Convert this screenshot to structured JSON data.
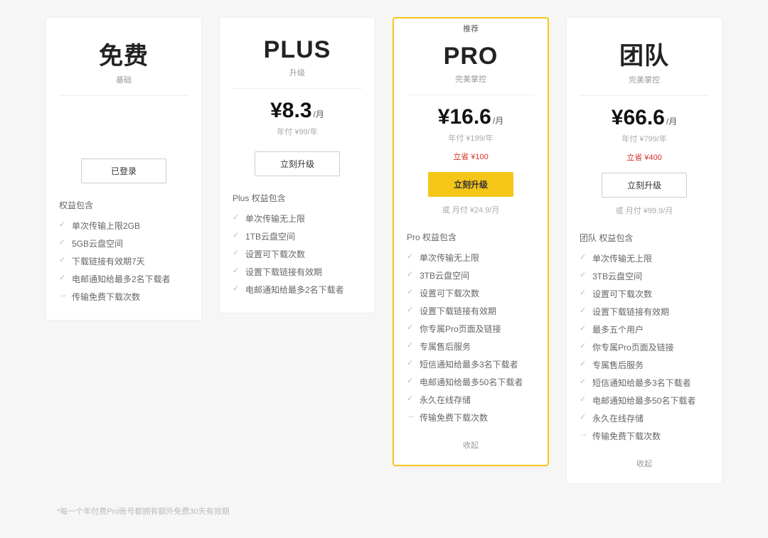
{
  "plans": {
    "free": {
      "title": "免费",
      "subtitle": "基础",
      "button": "已登录",
      "feat_title": "权益包含",
      "features": [
        "单次传输上限2GB",
        "5GB云盘空间",
        "下载链接有效期7天",
        "电邮通知给最多2名下载者",
        "传输免费下载次数"
      ]
    },
    "plus": {
      "title": "PLUS",
      "subtitle": "升级",
      "price": "¥8.3",
      "unit": "/月",
      "annual": "年付 ¥99/年",
      "button": "立刻升级",
      "feat_title": "Plus 权益包含",
      "features": [
        "单次传输无上限",
        "1TB云盘空间",
        "设置可下载次数",
        "设置下载链接有效期",
        "电邮通知给最多2名下载者"
      ]
    },
    "pro": {
      "recommend": "推荐",
      "title": "PRO",
      "subtitle": "完美掌控",
      "price": "¥16.6",
      "unit": "/月",
      "annual": "年付 ¥199/年",
      "save": "立省 ¥100",
      "button": "立刻升级",
      "monthly": "或 月付 ¥24.9/月",
      "feat_title": "Pro 权益包含",
      "features": [
        "单次传输无上限",
        "3TB云盘空间",
        "设置可下载次数",
        "设置下载链接有效期",
        "你专属Pro页面及链接",
        "专属售后服务",
        "短信通知给最多3名下载者",
        "电邮通知给最多50名下载者",
        "永久在线存储",
        "传输免费下载次数"
      ],
      "collapse": "收起"
    },
    "team": {
      "title": "团队",
      "subtitle": "完美掌控",
      "price": "¥66.6",
      "unit": "/月",
      "annual": "年付 ¥799/年",
      "save": "立省 ¥400",
      "button": "立刻升级",
      "monthly": "或 月付 ¥99.9/月",
      "feat_title": "团队 权益包含",
      "features": [
        "单次传输无上限",
        "3TB云盘空间",
        "设置可下载次数",
        "设置下载链接有效期",
        "最多五个用户",
        "你专属Pro页面及链接",
        "专属售后服务",
        "短信通知给最多3名下载者",
        "电邮通知给最多50名下载者",
        "永久在线存储",
        "传输免费下载次数"
      ],
      "collapse": "收起"
    }
  },
  "disclaimer": "*每一个年付费Pro账号都拥有额外免费30天有效期"
}
